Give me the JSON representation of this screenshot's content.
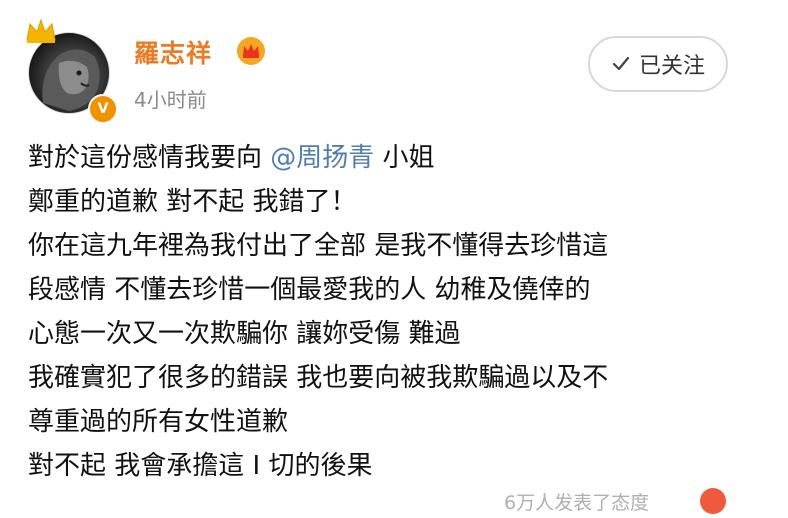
{
  "user": {
    "name": "羅志祥",
    "timestamp": "4小时前",
    "verified_badge": "V",
    "avatar_icon": "lion-avatar",
    "crown_icon": "crown-icon",
    "vip_icon": "vip-crown-icon"
  },
  "follow_button": {
    "label": "已关注",
    "icon": "check-icon"
  },
  "post": {
    "line1_prefix": "對於這份感情我要向 ",
    "mention": "@周扬青",
    "line1_suffix": " 小姐",
    "lines": [
      "鄭重的道歉 對不起 我錯了！",
      "你在這九年裡為我付出了全部 是我不懂得去珍惜這",
      "段感情 不懂去珍惜一個最愛我的人 幼稚及僥倖的",
      "心態一次又一次欺騙你 讓妳受傷 難過",
      "我確實犯了很多的錯誤 我也要向被我欺騙過以及不",
      "尊重過的所有女性道歉",
      "對不起   我會承擔這 I 切的後果"
    ]
  },
  "footer": {
    "text": "6万人发表了态度"
  },
  "colors": {
    "username": "#ec7b24",
    "mention": "#507daf",
    "badge": "#f29100",
    "timestamp": "#8a8a8a"
  }
}
